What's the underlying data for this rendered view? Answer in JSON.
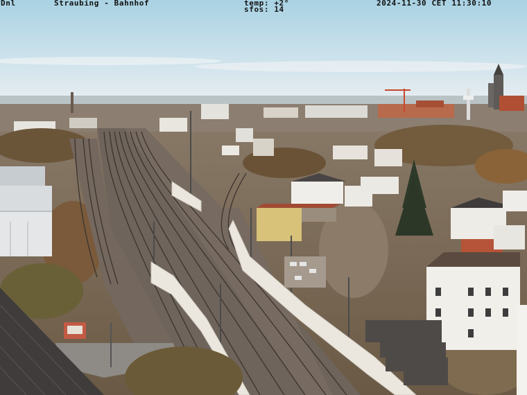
{
  "overlay": {
    "camera_id": "Dnl",
    "location": "Straubing - Bahnhof",
    "temperature": "temp: +2°",
    "sfos": "sfos: 14",
    "timestamp": "2024-11-30 CET 11:30:10"
  },
  "palette": {
    "sky_top": "#9cc8dc",
    "sky_bottom": "#dfe9ee",
    "town_far": "#8a7766",
    "foliage": "#6f5a3e",
    "rail_bed": "#6d625b",
    "wall": "#e8e4dc",
    "building_white": "#f0eee8",
    "roof_dark": "#3a3535",
    "roof_red": "#b2553b"
  }
}
